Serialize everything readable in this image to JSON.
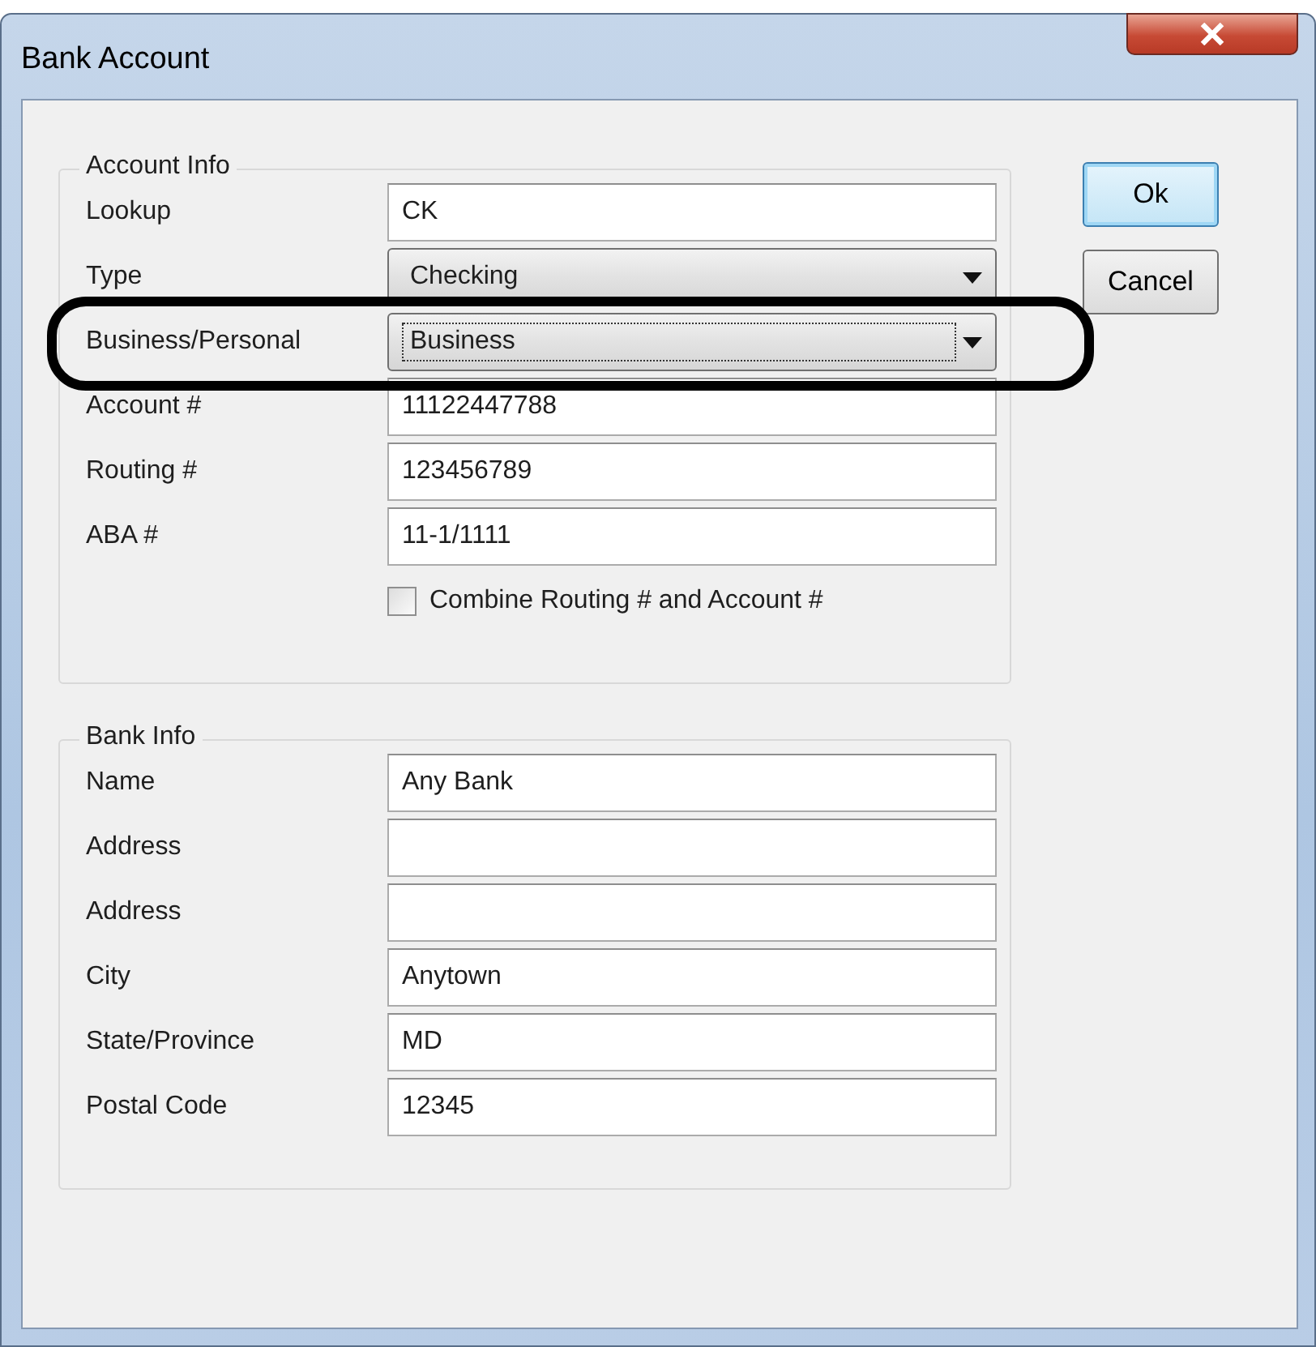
{
  "window": {
    "title": "Bank Account"
  },
  "groups": [
    {
      "title": "Account Info",
      "rows": [
        {
          "kind": "text",
          "label": "Lookup",
          "value": "CK"
        },
        {
          "kind": "dropdown",
          "label": "Type",
          "value": "Checking",
          "focused": false
        },
        {
          "kind": "dropdown",
          "label": "Business/Personal",
          "value": "Business",
          "focused": true,
          "annotated": true
        },
        {
          "kind": "text",
          "label": "Account #",
          "value": "11122447788"
        },
        {
          "kind": "text",
          "label": "Routing #",
          "value": "123456789"
        },
        {
          "kind": "text",
          "label": "ABA #",
          "value": "11-1/1111"
        },
        {
          "kind": "checkbox",
          "label": "Combine Routing # and Account #",
          "checked": false
        }
      ]
    },
    {
      "title": "Bank Info",
      "rows": [
        {
          "kind": "text",
          "label": "Name",
          "value": "Any Bank"
        },
        {
          "kind": "text",
          "label": "Address"
        },
        {
          "kind": "text",
          "label": "Address"
        },
        {
          "kind": "text",
          "label": "City",
          "value": "Anytown"
        },
        {
          "kind": "text",
          "label": "State/Province",
          "value": "MD"
        },
        {
          "kind": "text",
          "label": "Postal Code",
          "value": "12345"
        }
      ]
    }
  ],
  "buttons": [
    {
      "label": "Ok",
      "default": true
    },
    {
      "label": "Cancel",
      "default": false
    }
  ]
}
